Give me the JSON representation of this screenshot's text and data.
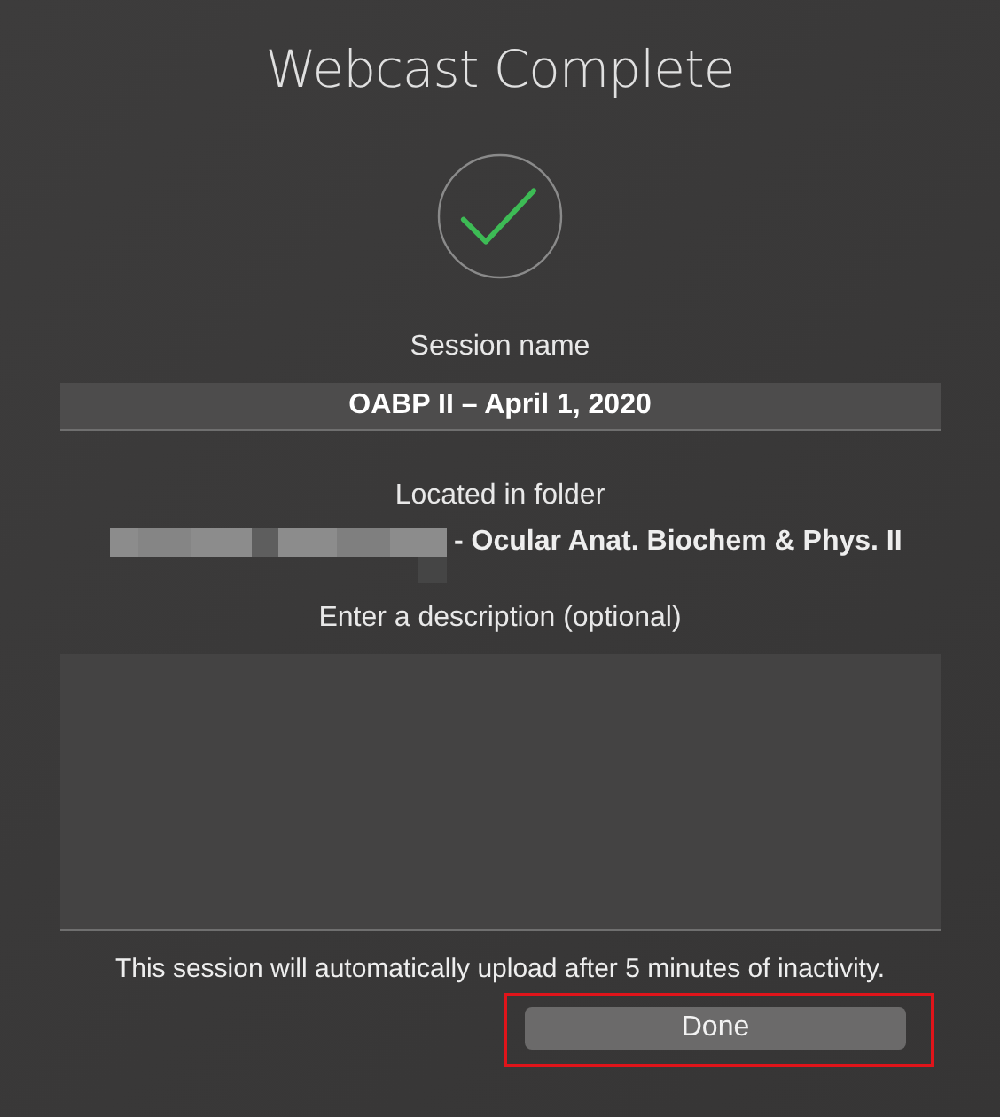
{
  "title": "Webcast Complete",
  "session": {
    "label": "Session name",
    "value": "OABP II – April 1, 2020"
  },
  "folder": {
    "label": "Located in folder",
    "value": "- Ocular Anat. Biochem & Phys. II",
    "redacted": true
  },
  "description": {
    "label": "Enter a description (optional)"
  },
  "notice": "This session will automatically upload after 5 minutes of inactivity.",
  "done_button": {
    "label": "Done",
    "highlighted": true
  }
}
